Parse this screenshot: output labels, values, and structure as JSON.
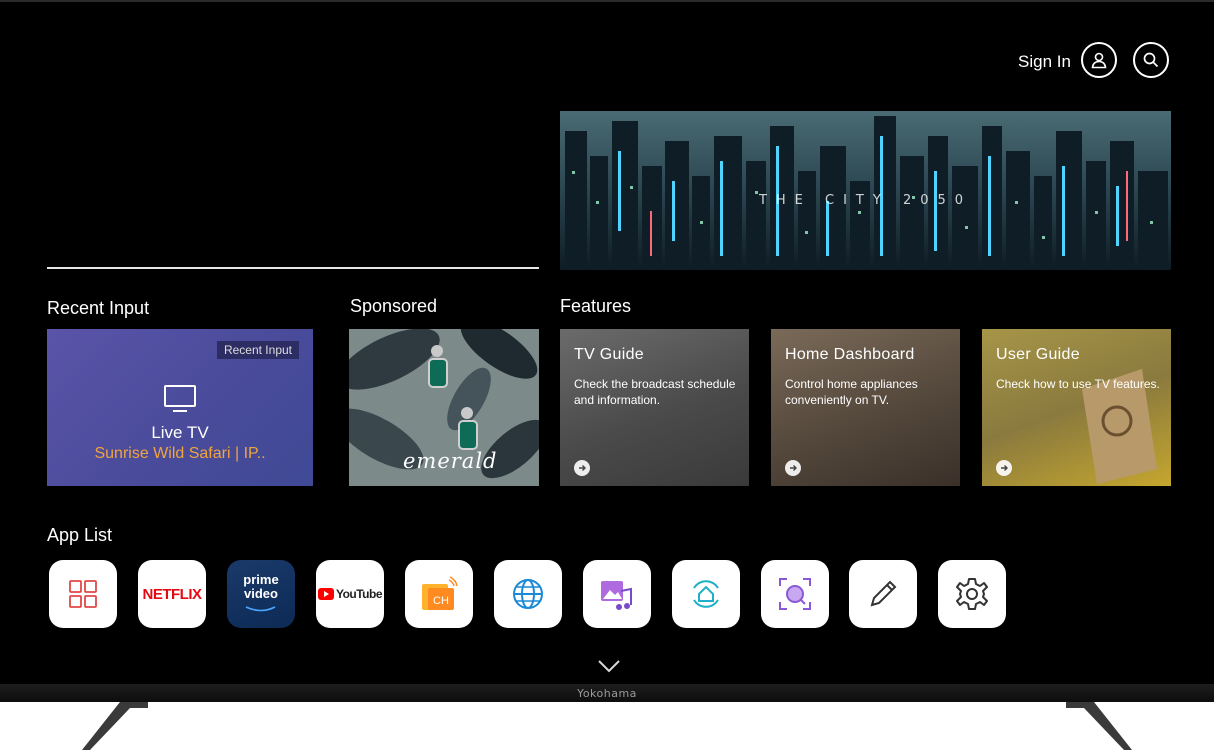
{
  "header": {
    "sign_in_label": "Sign In"
  },
  "hero": {
    "title": "THE CITY 2050"
  },
  "recent_input": {
    "section_title": "Recent Input",
    "badge": "Recent Input",
    "label": "Live TV",
    "channel": "Sunrise Wild Safari | IP..",
    "channel_color": "#f0a43c"
  },
  "sponsored": {
    "section_title": "Sponsored",
    "text": "emerald"
  },
  "features": {
    "section_title": "Features",
    "cards": [
      {
        "title": "TV Guide",
        "description": "Check the broadcast schedule and information."
      },
      {
        "title": "Home Dashboard",
        "description": "Control home appliances conveniently on TV."
      },
      {
        "title": "User Guide",
        "description": "Check how to use TV features."
      }
    ]
  },
  "app_list": {
    "section_title": "App List",
    "apps": [
      {
        "icon": "apps-grid-icon"
      },
      {
        "label": "NETFLIX"
      },
      {
        "label_line1": "prime",
        "label_line2": "video"
      },
      {
        "label": "YouTube"
      },
      {
        "label": "CH"
      },
      {
        "icon": "web-browser-icon"
      },
      {
        "icon": "media-player-icon"
      },
      {
        "icon": "home-hub-icon"
      },
      {
        "icon": "camera-scan-icon"
      },
      {
        "icon": "edit-pencil-icon"
      },
      {
        "icon": "settings-gear-icon"
      }
    ]
  },
  "brand": "Yokohama"
}
